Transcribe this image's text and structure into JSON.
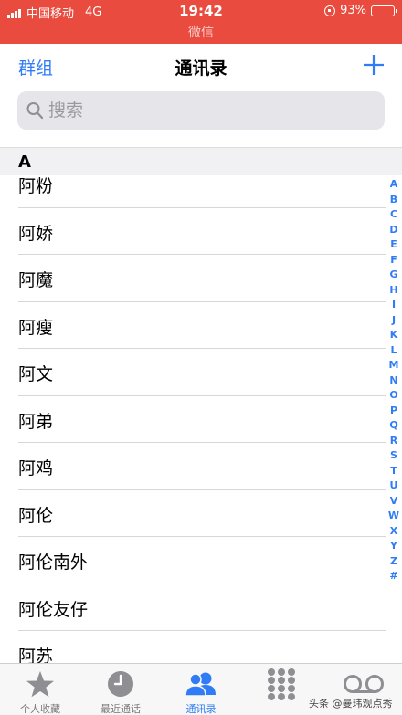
{
  "status_bar": {
    "carrier": "中国移动",
    "network": "4G",
    "time": "19:42",
    "subtitle": "微信",
    "battery": "93%",
    "battery_level": 0.93,
    "bar_color": "#e94b3f"
  },
  "nav": {
    "left_label": "群组",
    "title": "通讯录",
    "add_icon": "plus-icon",
    "accent": "#2f7cf6"
  },
  "search": {
    "placeholder": "搜索",
    "value": "",
    "icon": "search-icon"
  },
  "section": {
    "header": "A"
  },
  "contacts": [
    "阿粉",
    "阿娇",
    "阿魔",
    "阿瘦",
    "阿文",
    "阿弟",
    "阿鸡",
    "阿伦",
    "阿伦南外",
    "阿伦友仔",
    "阿苏"
  ],
  "index_letters": [
    "A",
    "B",
    "C",
    "D",
    "E",
    "F",
    "G",
    "H",
    "I",
    "J",
    "K",
    "L",
    "M",
    "N",
    "O",
    "P",
    "Q",
    "R",
    "S",
    "T",
    "U",
    "V",
    "W",
    "X",
    "Y",
    "Z",
    "#"
  ],
  "tabs": [
    {
      "label": "个人收藏",
      "icon": "star-icon",
      "active": false
    },
    {
      "label": "最近通话",
      "icon": "clock-icon",
      "active": false
    },
    {
      "label": "通讯录",
      "icon": "contacts-icon",
      "active": true
    },
    {
      "label": "",
      "icon": "keypad-icon",
      "active": false
    },
    {
      "label": "",
      "icon": "voicemail-icon",
      "active": false
    }
  ],
  "watermark": "头条 @曼玮观点秀"
}
